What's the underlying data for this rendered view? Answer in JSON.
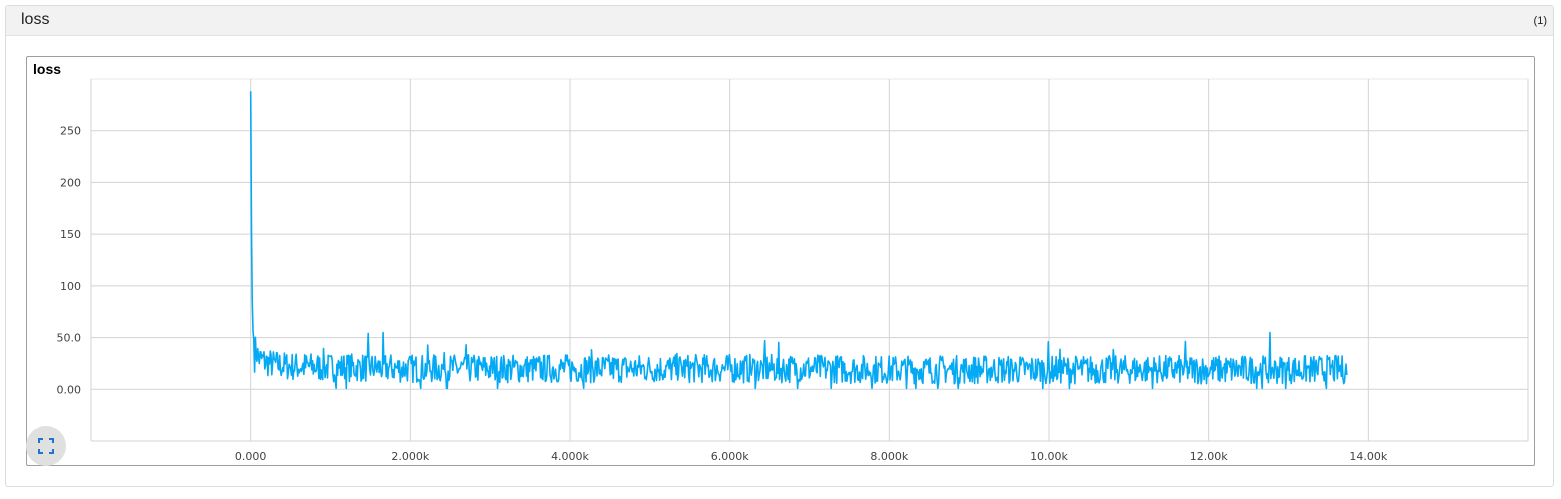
{
  "card": {
    "title": "loss",
    "count": "(1)"
  },
  "chart_data": {
    "type": "line",
    "title": "loss",
    "xlabel": "",
    "ylabel": "",
    "xlim": [
      -2000,
      16000
    ],
    "ylim": [
      -50,
      300
    ],
    "x_ticks": [
      0,
      2000,
      4000,
      6000,
      8000,
      10000,
      12000,
      14000
    ],
    "x_tick_labels": [
      "0.000",
      "2.000k",
      "4.000k",
      "6.000k",
      "8.000k",
      "10.00k",
      "12.00k",
      "14.00k"
    ],
    "y_ticks": [
      0,
      50,
      100,
      150,
      200,
      250
    ],
    "y_tick_labels": [
      "0.00",
      "50.0",
      "100",
      "150",
      "200",
      "250"
    ],
    "grid": true,
    "legend": "none",
    "series_color": "#03a9f4",
    "series": [
      {
        "x": [
          0,
          10,
          20,
          30,
          50,
          80,
          100,
          150,
          200,
          300,
          400,
          550,
          700,
          1000,
          1500,
          2000,
          3000,
          4000,
          5000,
          6000,
          7000,
          8000,
          9000,
          10000,
          11000,
          12000,
          13000,
          13740
        ],
        "y": [
          288,
          150,
          85,
          55,
          40,
          35,
          30,
          28,
          26,
          24,
          23,
          22,
          22,
          21,
          21,
          20,
          20,
          20,
          20,
          20,
          20,
          19,
          19,
          19,
          19,
          19,
          19,
          19
        ],
        "noise_low": 10,
        "noise_high": 14,
        "noise_peaks": 55
      }
    ]
  },
  "controls": {
    "expand_icon": "fullscreen-icon"
  }
}
